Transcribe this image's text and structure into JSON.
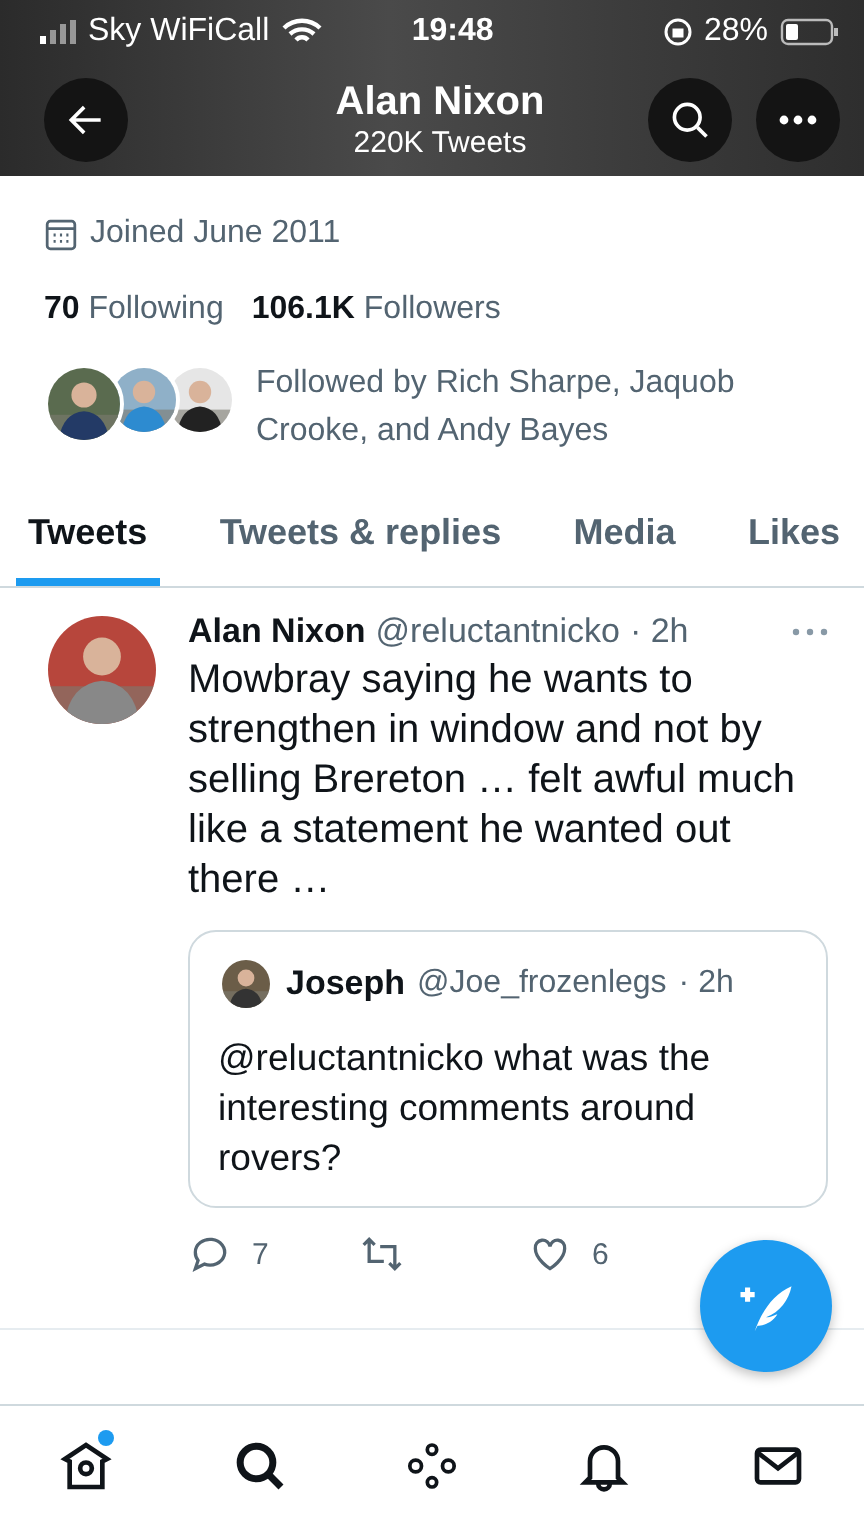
{
  "status_bar": {
    "carrier": "Sky WiFiCall",
    "time": "19:48",
    "battery": "28%"
  },
  "header": {
    "name": "Alan Nixon",
    "subtitle": "220K Tweets"
  },
  "profile": {
    "joined": "Joined June 2011",
    "stats": [
      {
        "count": "70",
        "label": "Following"
      },
      {
        "count": "106.1K",
        "label": "Followers"
      }
    ],
    "followed_by": "Followed by Rich Sharpe, Jaquob Crooke, and Andy Bayes"
  },
  "tabs": [
    {
      "label": "Tweets",
      "selected": true
    },
    {
      "label": "Tweets & replies",
      "selected": false
    },
    {
      "label": "Media",
      "selected": false
    },
    {
      "label": "Likes",
      "selected": false
    }
  ],
  "tweet": {
    "name": "Alan Nixon",
    "handle": "@reluctantnicko",
    "time": "· 2h",
    "text": "Mowbray saying he wants to strengthen in window and not by selling Brereton … felt awful much like a statement he wanted out there …",
    "quote": {
      "name": "Joseph",
      "handle": "@Joe_frozenlegs",
      "time": "· 2h",
      "text": "@reluctantnicko what was the interesting comments around rovers?"
    },
    "actions": [
      {
        "kind": "reply",
        "count": "7"
      },
      {
        "kind": "retweet"
      },
      {
        "kind": "like",
        "count": "6"
      }
    ]
  },
  "nav": [
    {
      "kind": "home",
      "unread": true
    },
    {
      "kind": "search",
      "unread": false
    },
    {
      "kind": "spaces",
      "unread": false
    },
    {
      "kind": "notifications",
      "unread": false
    },
    {
      "kind": "messages",
      "unread": false
    }
  ]
}
